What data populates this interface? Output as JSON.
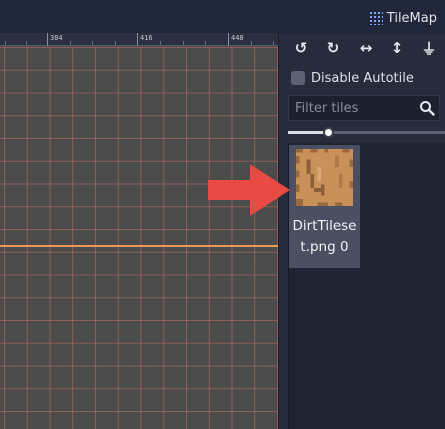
{
  "topbar": {
    "tab_label": "TileMap",
    "tab_icon": "tilemap-grid-icon"
  },
  "ruler": {
    "labels": [
      "384",
      "416",
      "448"
    ]
  },
  "toolbar": {
    "buttons": [
      {
        "name": "rotate-left-icon",
        "glyph": "↺"
      },
      {
        "name": "rotate-right-icon",
        "glyph": "↻"
      },
      {
        "name": "flip-horizontal-icon",
        "glyph": "↔"
      },
      {
        "name": "flip-vertical-icon",
        "glyph": "↕"
      },
      {
        "name": "clear-transform-icon",
        "glyph": "⏚"
      }
    ]
  },
  "autotile": {
    "label": "Disable Autotile",
    "checked": false
  },
  "filter": {
    "placeholder": "Filter tiles",
    "value": ""
  },
  "zoom_slider": {
    "value": 0.25
  },
  "tiles": [
    {
      "label": "DirtTileset.png 0",
      "selected": true
    }
  ],
  "colors": {
    "grid_line": "#be6e5f",
    "axis_line": "#e89a5a",
    "tile_fill": "#c8915a",
    "arrow": "#e94a44",
    "selection": "#4a5062"
  }
}
